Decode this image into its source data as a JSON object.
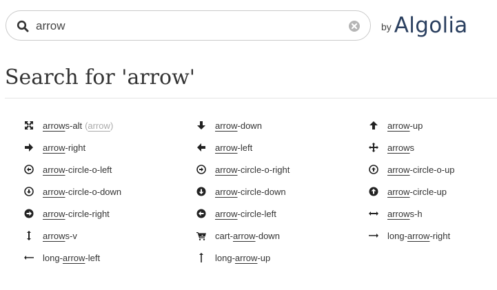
{
  "search": {
    "query": "arrow",
    "placeholder": ""
  },
  "branding": {
    "by_label": "by",
    "brand_name": "Algolia"
  },
  "heading": {
    "prefix": "Search for ",
    "query_quoted": "'arrow'"
  },
  "results": [
    {
      "parts": [
        {
          "t": "arrow",
          "h": true
        },
        {
          "t": "s-alt",
          "h": false
        }
      ],
      "alias": "arrow",
      "icon": "arrows-alt-icon"
    },
    {
      "parts": [
        {
          "t": "arrow",
          "h": true
        },
        {
          "t": "-down",
          "h": false
        }
      ],
      "icon": "arrow-down-icon"
    },
    {
      "parts": [
        {
          "t": "arrow",
          "h": true
        },
        {
          "t": "-up",
          "h": false
        }
      ],
      "icon": "arrow-up-icon"
    },
    {
      "parts": [
        {
          "t": "arrow",
          "h": true
        },
        {
          "t": "-right",
          "h": false
        }
      ],
      "icon": "arrow-right-icon"
    },
    {
      "parts": [
        {
          "t": "arrow",
          "h": true
        },
        {
          "t": "-left",
          "h": false
        }
      ],
      "icon": "arrow-left-icon"
    },
    {
      "parts": [
        {
          "t": "arrow",
          "h": true
        },
        {
          "t": "s",
          "h": false
        }
      ],
      "icon": "arrows-icon"
    },
    {
      "parts": [
        {
          "t": "arrow",
          "h": true
        },
        {
          "t": "-circle-o-left",
          "h": false
        }
      ],
      "icon": "arrow-circle-o-left-icon"
    },
    {
      "parts": [
        {
          "t": "arrow",
          "h": true
        },
        {
          "t": "-circle-o-right",
          "h": false
        }
      ],
      "icon": "arrow-circle-o-right-icon"
    },
    {
      "parts": [
        {
          "t": "arrow",
          "h": true
        },
        {
          "t": "-circle-o-up",
          "h": false
        }
      ],
      "icon": "arrow-circle-o-up-icon"
    },
    {
      "parts": [
        {
          "t": "arrow",
          "h": true
        },
        {
          "t": "-circle-o-down",
          "h": false
        }
      ],
      "icon": "arrow-circle-o-down-icon"
    },
    {
      "parts": [
        {
          "t": "arrow",
          "h": true
        },
        {
          "t": "-circle-down",
          "h": false
        }
      ],
      "icon": "arrow-circle-down-icon"
    },
    {
      "parts": [
        {
          "t": "arrow",
          "h": true
        },
        {
          "t": "-circle-up",
          "h": false
        }
      ],
      "icon": "arrow-circle-up-icon"
    },
    {
      "parts": [
        {
          "t": "arrow",
          "h": true
        },
        {
          "t": "-circle-right",
          "h": false
        }
      ],
      "icon": "arrow-circle-right-icon"
    },
    {
      "parts": [
        {
          "t": "arrow",
          "h": true
        },
        {
          "t": "-circle-left",
          "h": false
        }
      ],
      "icon": "arrow-circle-left-icon"
    },
    {
      "parts": [
        {
          "t": "arrow",
          "h": true
        },
        {
          "t": "s-h",
          "h": false
        }
      ],
      "icon": "arrows-h-icon"
    },
    {
      "parts": [
        {
          "t": "arrow",
          "h": true
        },
        {
          "t": "s-v",
          "h": false
        }
      ],
      "icon": "arrows-v-icon"
    },
    {
      "parts": [
        {
          "t": "cart-",
          "h": false
        },
        {
          "t": "arrow",
          "h": true
        },
        {
          "t": "-down",
          "h": false
        }
      ],
      "icon": "cart-arrow-down-icon"
    },
    {
      "parts": [
        {
          "t": "long-",
          "h": false
        },
        {
          "t": "arrow",
          "h": true
        },
        {
          "t": "-right",
          "h": false
        }
      ],
      "icon": "long-arrow-right-icon"
    },
    {
      "parts": [
        {
          "t": "long-",
          "h": false
        },
        {
          "t": "arrow",
          "h": true
        },
        {
          "t": "-left",
          "h": false
        }
      ],
      "icon": "long-arrow-left-icon"
    },
    {
      "parts": [
        {
          "t": "long-",
          "h": false
        },
        {
          "t": "arrow",
          "h": true
        },
        {
          "t": "-up",
          "h": false
        }
      ],
      "icon": "long-arrow-up-icon"
    }
  ],
  "colors": {
    "text": "#333333",
    "brand": "#2a3f5f",
    "muted": "#aaaaaa",
    "border": "#c9c9c9"
  }
}
